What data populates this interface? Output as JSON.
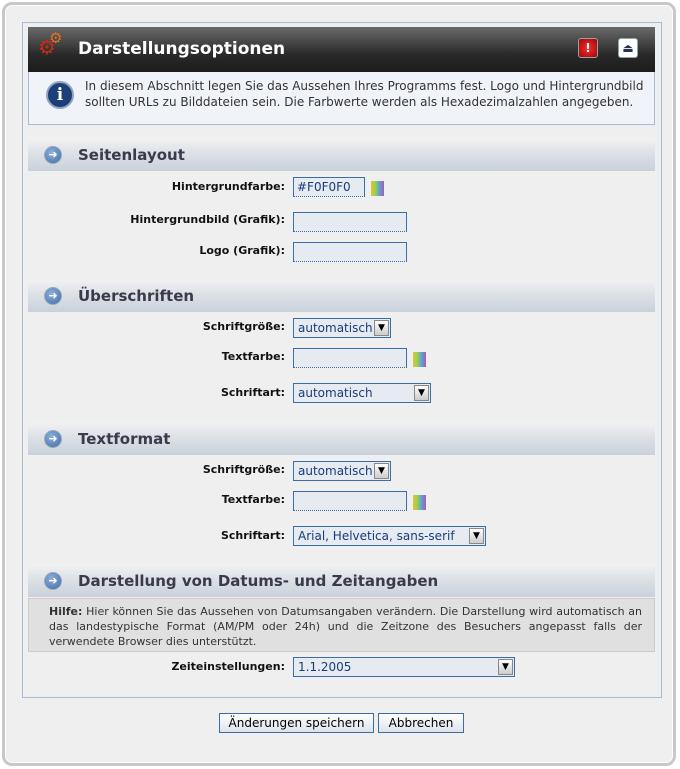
{
  "header": {
    "title": "Darstellungsoptionen",
    "icons": [
      "gears-icon",
      "alert-icon",
      "collapse-icon"
    ]
  },
  "info": {
    "text": "In diesem Abschnitt legen Sie das Aussehen Ihres Programms fest. Logo und Hintergrundbild sollten URLs zu Bilddateien sein. Die Farbwerte werden als Hexadezimalzahlen angegeben."
  },
  "seitenlayout": {
    "title": "Seitenlayout",
    "bg_color_label": "Hintergrundfarbe:",
    "bg_color_value": "#F0F0F0",
    "bg_image_label": "Hintergrundbild (Grafik):",
    "bg_image_value": "",
    "logo_label": "Logo (Grafik):",
    "logo_value": ""
  },
  "ueberschriften": {
    "title": "Überschriften",
    "size_label": "Schriftgröße:",
    "size_value": "automatisch",
    "color_label": "Textfarbe:",
    "color_value": "",
    "font_label": "Schriftart:",
    "font_value": "automatisch"
  },
  "textformat": {
    "title": "Textformat",
    "size_label": "Schriftgröße:",
    "size_value": "automatisch",
    "color_label": "Textfarbe:",
    "color_value": "",
    "font_label": "Schriftart:",
    "font_value": "Arial, Helvetica, sans-serif"
  },
  "datum": {
    "title": "Darstellung von Datums- und Zeitangaben",
    "help_label": "Hilfe:",
    "help_text": "Hier können Sie das Aussehen von Datumsangaben verändern. Die Darstellung wird automatisch an das landestypische Format (AM/PM oder 24h) und die Zeitzone des Besuchers angepasst falls der verwendete Browser dies unterstützt.",
    "time_label": "Zeiteinstellungen:",
    "time_value": "1.1.2005"
  },
  "buttons": {
    "save": "Änderungen speichern",
    "cancel": "Abbrechen"
  }
}
